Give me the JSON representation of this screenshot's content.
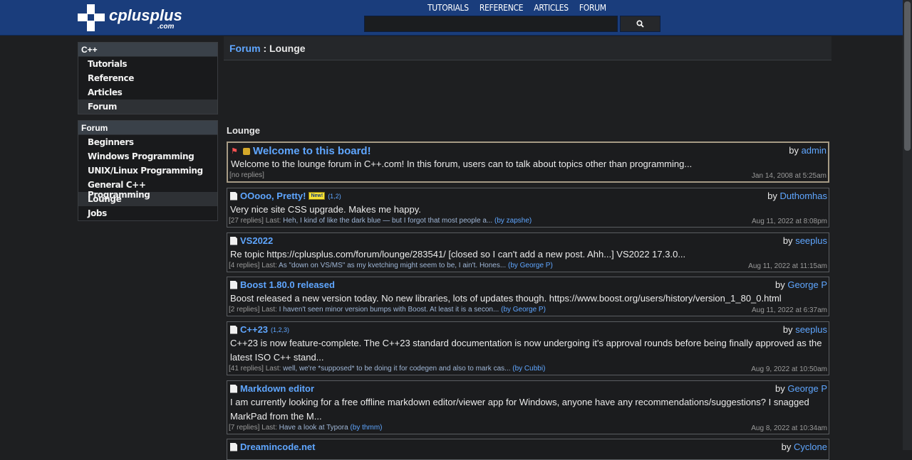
{
  "header": {
    "logo_text": "cplusplus",
    "logo_sub": ".com",
    "nav": [
      "TUTORIALS",
      "REFERENCE",
      "ARTICLES",
      "FORUM"
    ],
    "search_placeholder": ""
  },
  "sidebar": {
    "cpp": {
      "title": "C++",
      "items": [
        "Tutorials",
        "Reference",
        "Articles",
        "Forum"
      ]
    },
    "forum": {
      "title": "Forum",
      "items": [
        "Beginners",
        "Windows Programming",
        "UNIX/Linux Programming",
        "General C++ Programming",
        "Lounge",
        "Jobs"
      ]
    }
  },
  "breadcrumb": {
    "link": "Forum",
    "sep": " : ",
    "current": "Lounge"
  },
  "section_title": "Lounge",
  "threads": [
    {
      "title": "Welcome to this board!",
      "author": "admin",
      "by": "by",
      "excerpt": "Welcome to the lounge forum in C++.com! In this forum, users can to talk about topics other than programming...",
      "replies": "[no replies]",
      "date": "Jan 14, 2008 at 5:25am"
    },
    {
      "title": "OOooo, Pretty!",
      "badge": "New!",
      "pages": "(1,2)",
      "author": "Duthomhas",
      "by": "by",
      "excerpt": "Very nice site CSS upgrade. Makes me happy.",
      "replies": "[27 replies] Last:",
      "last_post": "Heh, I kind of like the dark blue — but I forgot that most people a...",
      "last_by": "(by zapshe)",
      "date": "Aug 11, 2022 at 8:08pm"
    },
    {
      "title": "VS2022",
      "author": "seeplus",
      "by": "by",
      "excerpt": "Re topic https://cplusplus.com/forum/lounge/283541/ [closed so I can't add a new post. Ahh...] VS2022 17.3.0...",
      "replies": "[4 replies] Last:",
      "last_post": "As \"down on VS/MS\" as my kvetching might seem to be, I ain't. Hones...",
      "last_by": "(by George P)",
      "date": "Aug 11, 2022 at 11:15am"
    },
    {
      "title": "Boost 1.80.0 released",
      "author": "George P",
      "by": "by",
      "excerpt": "Boost released a new version today. No new libraries, lots of updates though. https://www.boost.org/users/history/version_1_80_0.html",
      "replies": "[2 replies] Last:",
      "last_post": "I haven't seen minor version bumps with Boost. At least it is a secon...",
      "last_by": "(by George P)",
      "date": "Aug 11, 2022 at 6:37am"
    },
    {
      "title": "C++23",
      "pages": "(1,2,3)",
      "author": "seeplus",
      "by": "by",
      "excerpt": "C++23 is now feature-complete. The C++23 standard documentation is now undergoing it's approval rounds before being finally approved as the latest ISO C++ stand...",
      "replies": "[41 replies] Last:",
      "last_post": "well, we're *supposed* to be doing it for codegen and also to mark cas...",
      "last_by": "(by Cubbi)",
      "date": "Aug 9, 2022 at 10:50am"
    },
    {
      "title": "Markdown editor",
      "author": "George P",
      "by": "by",
      "excerpt": "I am currently looking for a free offline markdown editor/viewer app for Windows, anyone have any recommendations/suggestions? I snagged MarkPad from the M...",
      "replies": "[7 replies] Last:",
      "last_post": "Have a look at Typora",
      "last_by": "(by thmm)",
      "date": "Aug 8, 2022 at 10:34am"
    },
    {
      "title": "Dreamincode.net",
      "author": "Cyclone",
      "by": "by"
    }
  ]
}
